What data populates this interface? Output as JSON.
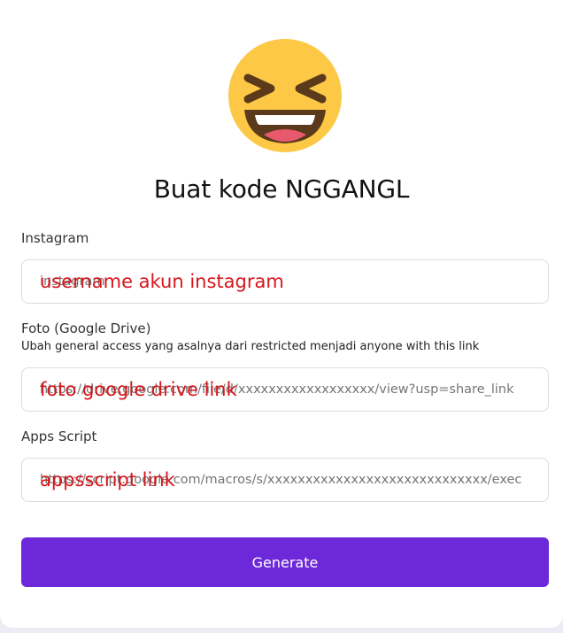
{
  "form": {
    "title": "Buat kode NGGANGL",
    "instagram": {
      "label": "Instagram",
      "placeholder": "instagram",
      "annotation": "username akun instagram"
    },
    "photo": {
      "label": "Foto (Google Drive)",
      "hint": "Ubah general access yang asalnya dari restricted menjadi anyone with this link",
      "placeholder": "https://drive.google.com/file/d/xxxxxxxxxxxxxxxxxx/view?usp=share_link",
      "annotation": "foto google drive link"
    },
    "apps_script": {
      "label": "Apps Script",
      "placeholder": "https://script.google.com/macros/s/xxxxxxxxxxxxxxxxxxxxxxxxxxxxx/exec",
      "annotation": "appsscript link"
    },
    "generate_label": "Generate"
  },
  "colors": {
    "accent": "#6d28d9",
    "annotation": "#d6161c",
    "emoji_face": "#fcc846",
    "emoji_features": "#5a3a1a",
    "page_background": "#ececf4"
  },
  "icons": {
    "hero": "grinning-squinting-face-emoji"
  }
}
